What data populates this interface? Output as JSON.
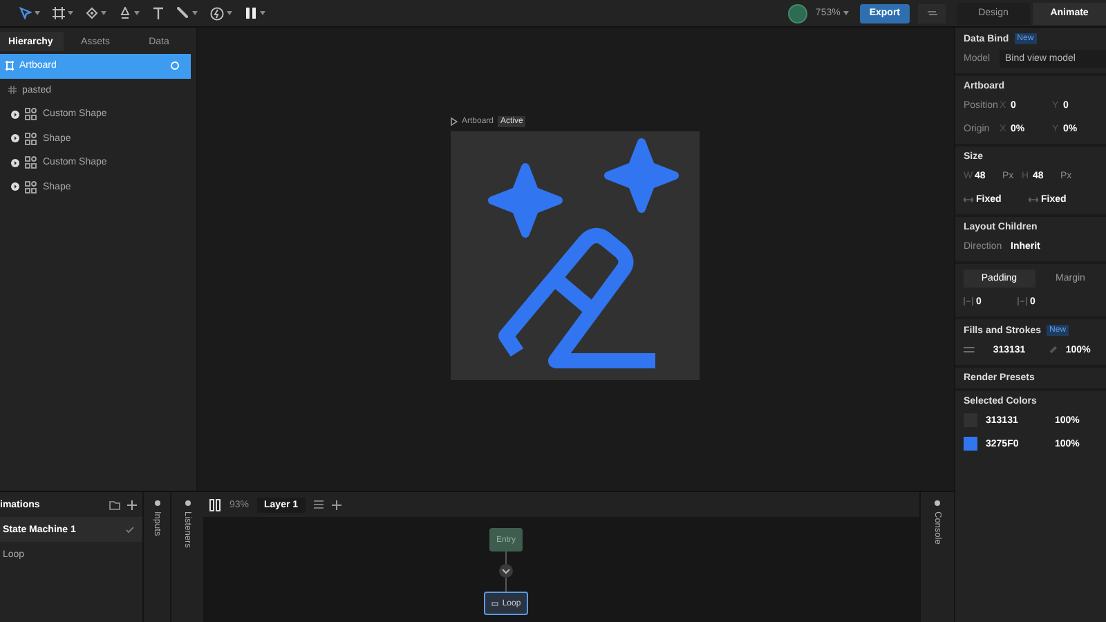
{
  "toolbar": {
    "zoom": "753%",
    "export": "Export",
    "mode_tabs": [
      {
        "label": "Design",
        "selected": false
      },
      {
        "label": "Animate",
        "selected": true
      }
    ]
  },
  "hierarchy": {
    "tabs": [
      {
        "label": "Hierarchy",
        "selected": true
      },
      {
        "label": "Assets",
        "selected": false
      },
      {
        "label": "Data",
        "selected": false
      }
    ],
    "tree": [
      {
        "label": "Artboard",
        "kind": "artboard",
        "selected": true,
        "children": [
          {
            "label": "pasted",
            "kind": "group",
            "selected": false,
            "children": [
              {
                "label": "Custom Shape",
                "kind": "shape",
                "selected": false,
                "expanded": false
              },
              {
                "label": "Shape",
                "kind": "shape",
                "selected": false,
                "expanded": false
              },
              {
                "label": "Custom Shape",
                "kind": "shape",
                "selected": false,
                "expanded": false
              },
              {
                "label": "Shape",
                "kind": "shape",
                "selected": false,
                "expanded": false
              }
            ]
          }
        ]
      }
    ]
  },
  "canvas": {
    "artboard_label": "Artboard",
    "artboard_badge": "Active"
  },
  "inspector": {
    "data_bind": {
      "title": "Data Bind",
      "badge": "New",
      "model_label": "Model",
      "model_value": "Bind view model"
    },
    "artboard": {
      "title": "Artboard",
      "position_label": "Position",
      "origin_label": "Origin",
      "position": [
        {
          "axis": "X",
          "value": "0"
        },
        {
          "axis": "Y",
          "value": "0"
        }
      ],
      "origin": [
        {
          "axis": "X",
          "value": "0%"
        },
        {
          "axis": "Y",
          "value": "0%"
        }
      ]
    },
    "size": {
      "title": "Size",
      "fields": [
        {
          "axis": "W",
          "value": "48",
          "unit": "Px"
        },
        {
          "axis": "H",
          "value": "48",
          "unit": "Px"
        }
      ],
      "modes": [
        "Fixed",
        "Fixed"
      ]
    },
    "layout": {
      "title": "Layout Children",
      "direction_label": "Direction",
      "direction_value": "Inherit"
    },
    "spacing_tabs": [
      {
        "label": "Padding",
        "selected": true
      },
      {
        "label": "Margin",
        "selected": false
      }
    ],
    "spacing_values": [
      "0",
      "0"
    ],
    "fills": {
      "title": "Fills and Strokes",
      "badge": "New",
      "hex": "313131",
      "opacity": "100%"
    },
    "render_presets": {
      "title": "Render Presets"
    },
    "selected_colors": {
      "title": "Selected Colors",
      "items": [
        {
          "hex": "313131",
          "opacity": "100%",
          "color": "#313131"
        },
        {
          "hex": "3275F0",
          "opacity": "100%",
          "color": "#3275f0"
        }
      ]
    }
  },
  "animations": {
    "title": "imations",
    "items": [
      {
        "label": "State Machine 1",
        "selected": true
      },
      {
        "label": "Loop",
        "selected": false
      }
    ]
  },
  "side_tabs": [
    "Inputs",
    "Listeners"
  ],
  "graph": {
    "zoom": "93%",
    "layer": "Layer 1",
    "entry": "Entry",
    "state": "Loop"
  },
  "console": "Console"
}
